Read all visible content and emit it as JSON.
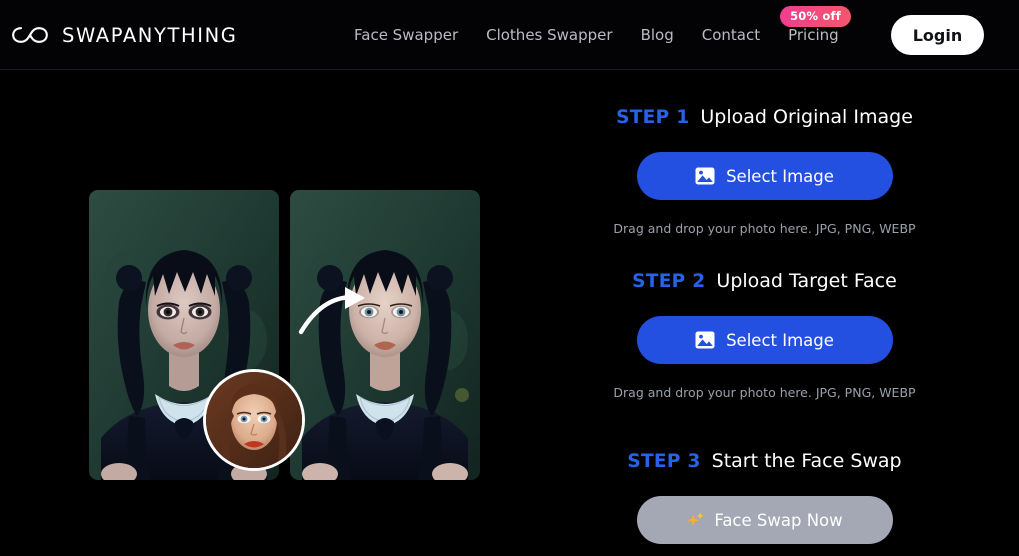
{
  "header": {
    "logo_icon": "infinity-icon",
    "brand": "SWAPANYTHING",
    "nav": [
      {
        "label": "Face Swapper"
      },
      {
        "label": "Clothes Swapper"
      },
      {
        "label": "Blog"
      },
      {
        "label": "Contact"
      },
      {
        "label": "Pricing",
        "badge": "50% off"
      }
    ],
    "login_label": "Login"
  },
  "preview": {
    "before_alt": "Original portrait photo",
    "after_alt": "Face swapped result photo",
    "face_thumb_alt": "Target face thumbnail",
    "arrow_icon": "curved-arrow-icon"
  },
  "steps": [
    {
      "number": "STEP 1",
      "title": "Upload Original Image",
      "button_label": "Select Image",
      "button_icon": "picture-icon",
      "hint": "Drag and drop your photo here. JPG, PNG, WEBP"
    },
    {
      "number": "STEP 2",
      "title": "Upload Target Face",
      "button_label": "Select Image",
      "button_icon": "picture-icon",
      "hint": "Drag and drop your photo here. JPG, PNG, WEBP"
    },
    {
      "number": "STEP 3",
      "title": "Start the Face Swap",
      "button_label": "Face Swap Now",
      "button_icon": "sparkles-icon",
      "button_disabled": true
    }
  ],
  "colors": {
    "background": "#000000",
    "accent_blue": "#2563eb",
    "button_blue": "#2350e0",
    "disabled_gray": "#a3a8b4",
    "badge_pink": "#ef3d8f",
    "badge_red": "#f6576c",
    "hint_gray": "#9aa0aa",
    "nav_gray": "#b9bcc4"
  }
}
